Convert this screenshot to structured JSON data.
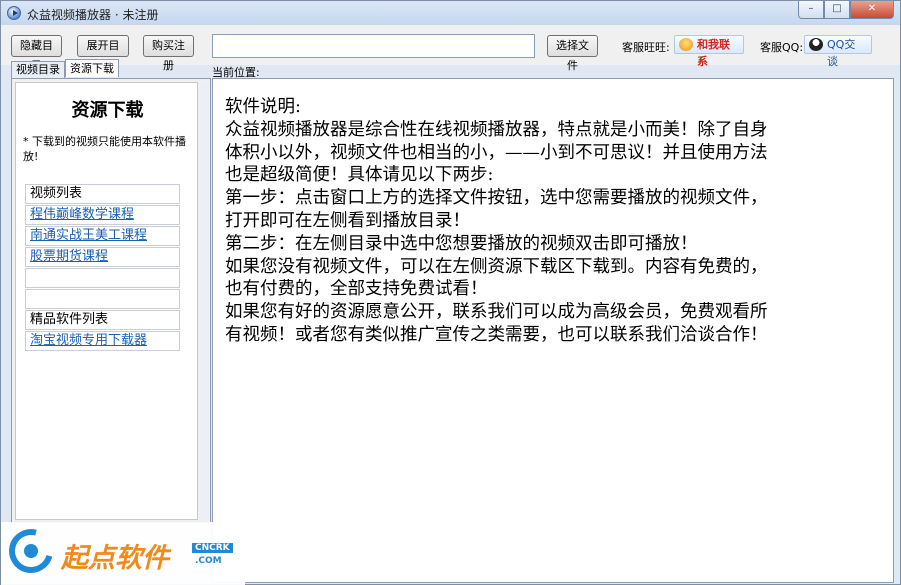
{
  "window": {
    "title": "众益视频播放器 · 未注册",
    "controls": {
      "minimize": "–",
      "maximize": "□",
      "close": "✕"
    }
  },
  "toolbar": {
    "hide_catalog": "隐藏目录",
    "expand_catalog": "展开目录",
    "buy_register": "购买注册",
    "path_value": "",
    "select_file": "选择文件",
    "wangwang_label": "客服旺旺:",
    "wangwang_button": "和我联系",
    "qq_label": "客服QQ:",
    "qq_button": "QQ交谈"
  },
  "tabs": [
    "视频目录",
    "资源下载"
  ],
  "location_label": "当前位置:",
  "left_panel": {
    "title": "资源下载",
    "note": "* 下载到的视频只能使用本软件播放!",
    "video_list_header": "视频列表",
    "video_links": [
      "程伟巅峰数学课程",
      "南通实战王美工课程",
      "股票期货课程",
      "",
      ""
    ],
    "software_list_header": "精品软件列表",
    "software_links": [
      "淘宝视频专用下载器"
    ]
  },
  "main": {
    "lines": [
      "软件说明:",
      "众益视频播放器是综合性在线视频播放器，特点就是小而美！除了自身",
      "体积小以外，视频文件也相当的小，——小到不可思议！并且使用方法",
      "也是超级简便！具体请见以下两步:",
      "第一步：点击窗口上方的选择文件按钮，选中您需要播放的视频文件，",
      "打开即可在左侧看到播放目录！",
      "第二步：在左侧目录中选中您想要播放的视频双击即可播放！",
      "如果您没有视频文件，可以在左侧资源下载区下载到。内容有免费的，",
      "也有付费的，全部支持免费试看！",
      "如果您有好的资源愿意公开，联系我们可以成为高级会员，免费观看所",
      "有视频！或者您有类似推广宣传之类需要，也可以联系我们洽谈合作！"
    ]
  },
  "watermark": {
    "brand": "起点软件",
    "sub1": "CNCRK",
    "sub2": ".COM"
  },
  "icons": {
    "app": "play-circle-icon",
    "wangwang": "wangwang-icon",
    "qq": "qq-penguin-icon"
  }
}
